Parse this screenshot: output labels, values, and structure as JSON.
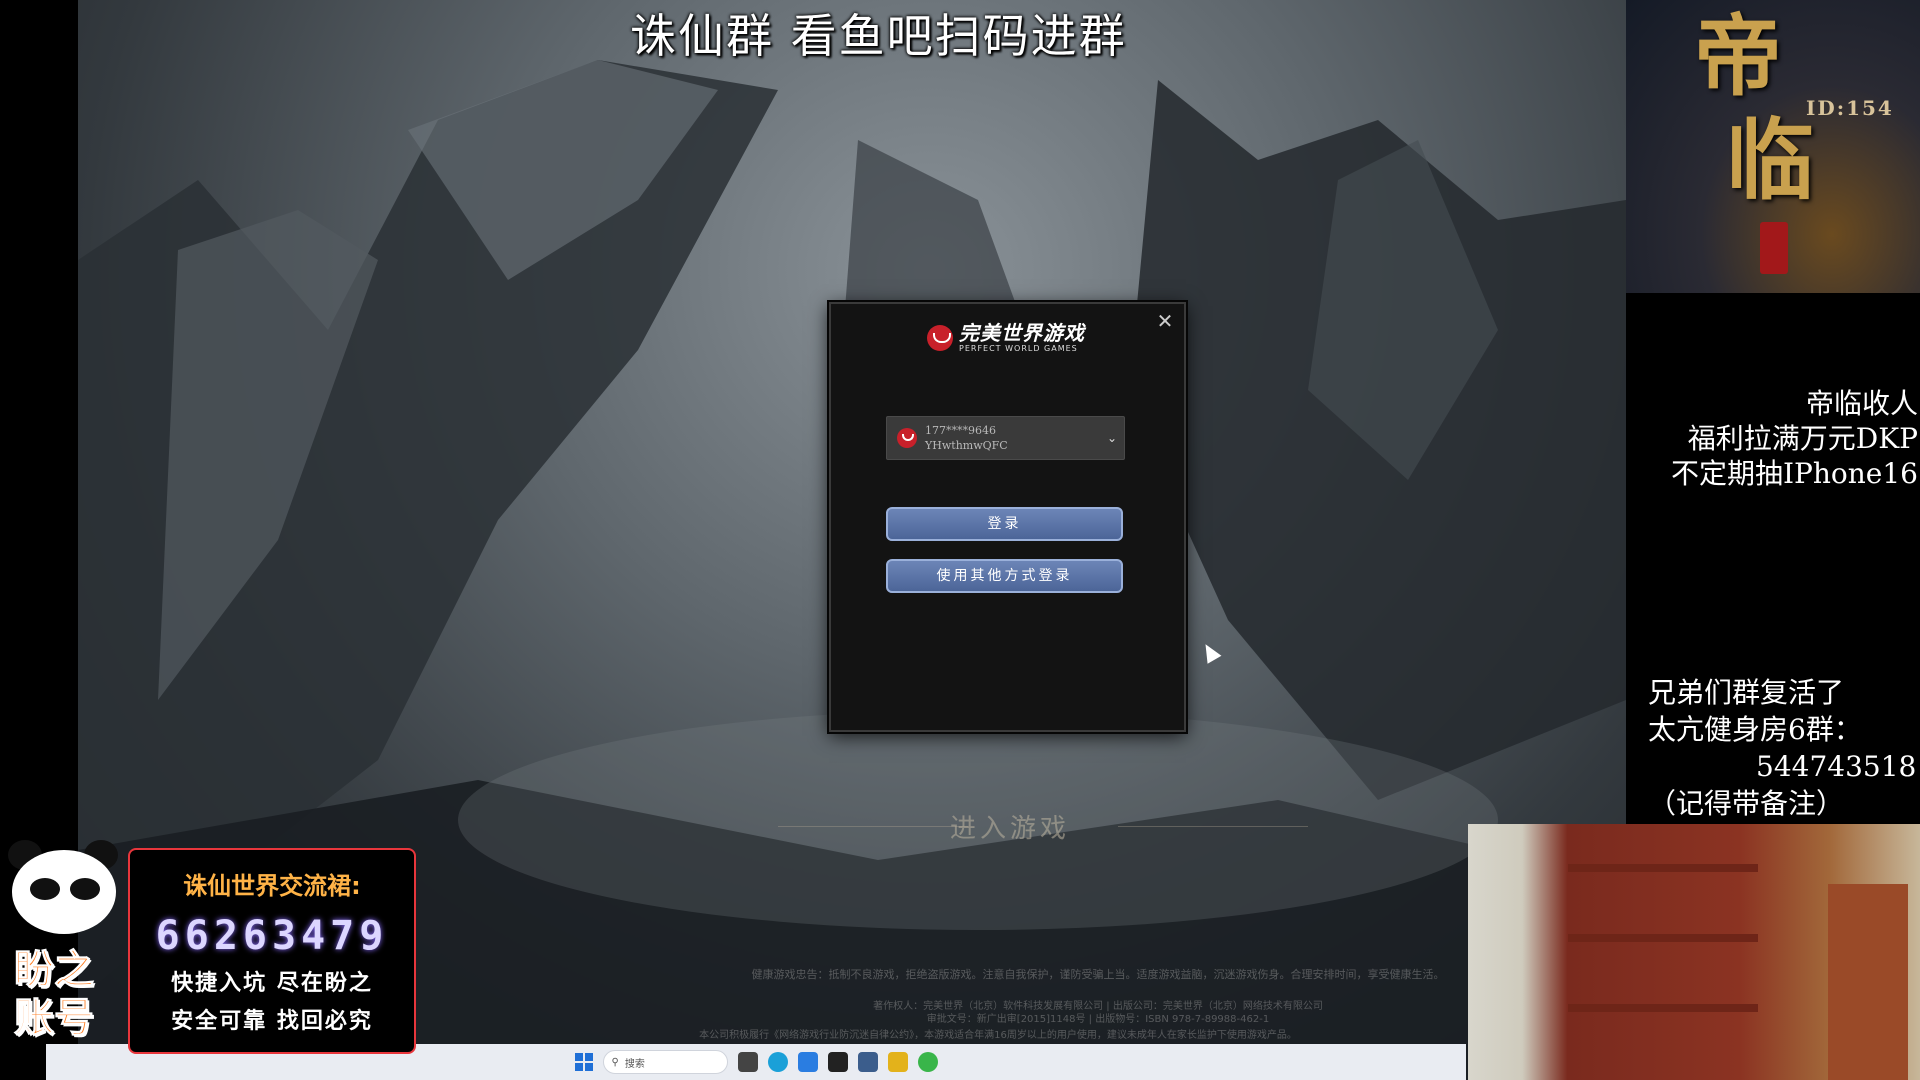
{
  "overlay": {
    "top_title": "诛仙群 看鱼吧扫码进群"
  },
  "dialog": {
    "logo_cn": "完美世界游戏",
    "logo_en": "PERFECT WORLD GAMES",
    "close_icon": "close-icon",
    "account": {
      "phone": "177****9646",
      "id": "YHwthmwQFC"
    },
    "login_button": "登录",
    "other_login_button": "使用其他方式登录"
  },
  "game": {
    "enter_game": "进入游戏",
    "health_notice": "健康游戏忠告：抵制不良游戏，拒绝盗版游戏。注意自我保护，谨防受骗上当。适度游戏益脑，沉迷游戏伤身。合理安排时间，享受健康生活。",
    "publisher_line": "著作权人：完美世界（北京）软件科技发展有限公司 | 出版公司：完美世界（北京）网络技术有限公司",
    "approval_line": "审批文号：新广出审[2015]1148号 | 出版物号：ISBN 978-7-89988-462-1",
    "legal_line": "本公司积极履行《网络游戏行业防沉迷自律公约》，本游戏适合年满16周岁以上的用户使用，建议未成年人在家长监护下使用游戏产品。"
  },
  "taskbar": {
    "search_placeholder": "搜索"
  },
  "branding": {
    "char1": "帝",
    "char2": "临",
    "id_text": "ID:154"
  },
  "side_notice_1": {
    "line1": "帝临收人",
    "line2": "福利拉满万元DKP",
    "line3": "不定期抽IPhone16"
  },
  "side_notice_2": {
    "line1": "兄弟们群复活了",
    "line2": "太亢健身房6群：",
    "line3": "544743518",
    "line4": "（记得带备注）"
  },
  "ad": {
    "name_line1": "盼之",
    "name_line2": "账号",
    "title": "诛仙世界交流裙:",
    "number": "66263479",
    "slogan1": "快捷入坑 尽在盼之",
    "slogan2": "安全可靠 找回必究"
  }
}
